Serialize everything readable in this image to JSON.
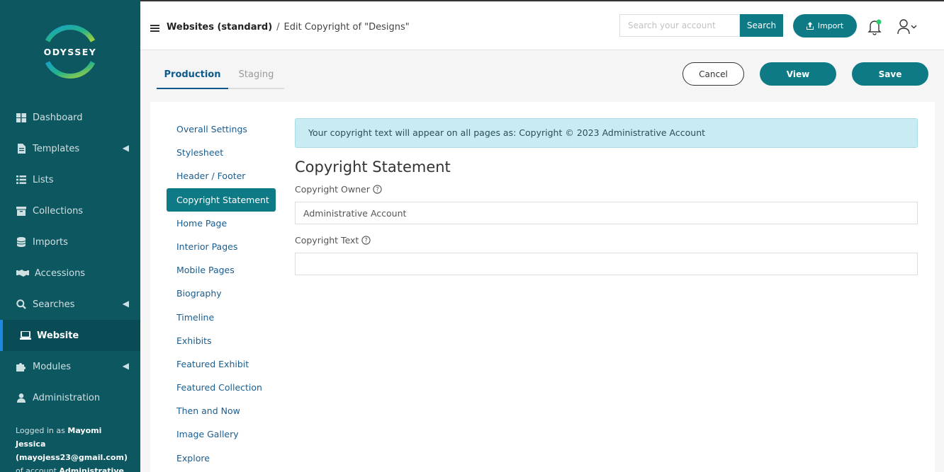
{
  "brand": {
    "name": "ODYSSEY"
  },
  "sidebar": {
    "items": [
      {
        "label": "Dashboard",
        "icon": "dashboard-icon",
        "has_chevron": false
      },
      {
        "label": "Templates",
        "icon": "file-icon",
        "has_chevron": true
      },
      {
        "label": "Lists",
        "icon": "list-icon",
        "has_chevron": false
      },
      {
        "label": "Collections",
        "icon": "archive-icon",
        "has_chevron": false
      },
      {
        "label": "Imports",
        "icon": "database-icon",
        "has_chevron": false
      },
      {
        "label": "Accessions",
        "icon": "handshake-icon",
        "has_chevron": false
      },
      {
        "label": "Searches",
        "icon": "search-icon",
        "has_chevron": true
      },
      {
        "label": "Website",
        "icon": "laptop-icon",
        "has_chevron": false,
        "active": true
      },
      {
        "label": "Modules",
        "icon": "puzzle-icon",
        "has_chevron": true
      },
      {
        "label": "Administration",
        "icon": "user-icon",
        "has_chevron": false
      }
    ],
    "logged_in": {
      "prefix": "Logged in as ",
      "user": "Mayomi Jessica",
      "email": "(mayojess23@gmail.com)",
      "middle": " of account ",
      "account": "Administrative Account"
    }
  },
  "header": {
    "breadcrumb_root": "Websites (standard)",
    "breadcrumb_sep": "/",
    "breadcrumb_current": "Edit Copyright of \"Designs\"",
    "search_placeholder": "Search your account",
    "search_label": "Search",
    "import_label": "Import"
  },
  "tabs": [
    {
      "label": "Production",
      "active": true
    },
    {
      "label": "Staging",
      "active": false
    }
  ],
  "actions": {
    "cancel": "Cancel",
    "view": "View",
    "save": "Save"
  },
  "subnav": [
    "Overall Settings",
    "Stylesheet",
    "Header / Footer",
    "Copyright Statement",
    "Home Page",
    "Interior Pages",
    "Mobile Pages",
    "Biography",
    "Timeline",
    "Exhibits",
    "Featured Exhibit",
    "Featured Collection",
    "Then and Now",
    "Image Gallery",
    "Explore"
  ],
  "subnav_active": "Copyright Statement",
  "main": {
    "alert": "Your copyright text will appear on all pages as: Copyright © 2023 Administrative Account",
    "title": "Copyright Statement",
    "owner_label": "Copyright Owner",
    "owner_value": "Administrative Account",
    "text_label": "Copyright Text",
    "text_value": ""
  },
  "colors": {
    "sidebar_bg": "#0d5761",
    "accent": "#0e7a86",
    "link": "#1a5d8e",
    "alert_bg": "#c8ecf1"
  }
}
